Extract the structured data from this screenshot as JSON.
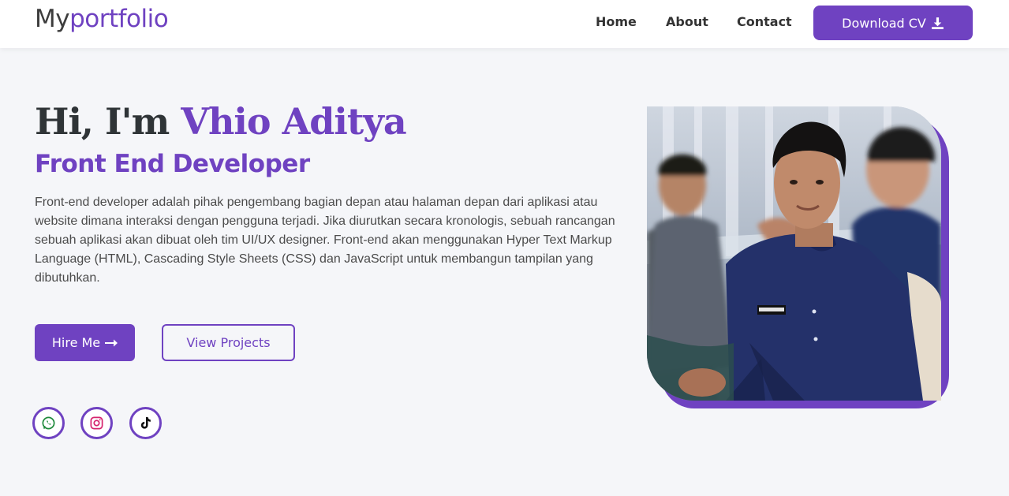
{
  "nav": {
    "logo_prefix": "My",
    "logo_accent": "portfolio",
    "links": [
      "Home",
      "About",
      "Contact"
    ],
    "cv_button": "Download CV"
  },
  "hero": {
    "greeting": "Hi, I'm ",
    "name": "Vhio Aditya",
    "role": "Front End Developer",
    "description": "Front-end developer adalah pihak pengembang bagian depan atau halaman depan dari aplikasi atau website dimana interaksi dengan pengguna terjadi. Jika diurutkan secara kronologis, sebuah rancangan sebuah aplikasi akan dibuat oleh tim UI/UX designer. Front-end akan menggunakan Hyper Text Markup Language (HTML), Cascading Style Sheets (CSS) dan JavaScript untuk membangun tampilan yang dibutuhkan.",
    "hire_button": "Hire Me",
    "projects_button": "View Projects"
  },
  "social": [
    {
      "icon": "whatsapp-icon"
    },
    {
      "icon": "instagram-icon"
    },
    {
      "icon": "tiktok-icon"
    }
  ],
  "colors": {
    "accent": "#6f42c1",
    "background": "#f5f6f9",
    "text": "#333333"
  }
}
